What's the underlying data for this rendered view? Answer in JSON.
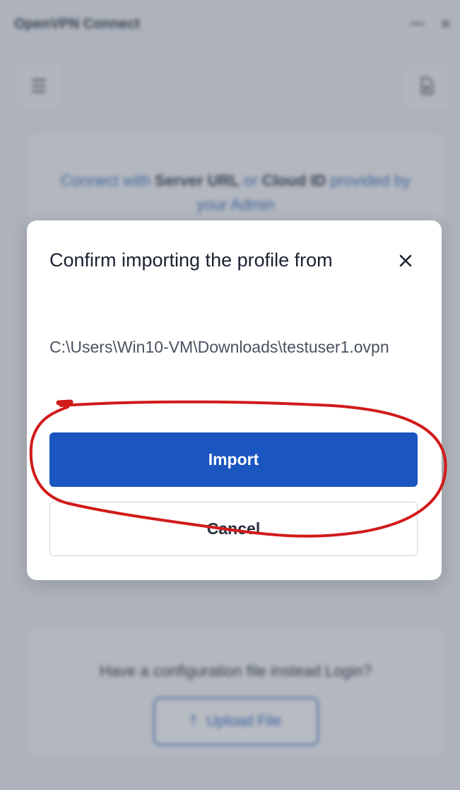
{
  "window": {
    "title": "OpenVPN Connect",
    "minimize_glyph": "—",
    "close_glyph": "✕"
  },
  "toolbar": {
    "menu_icon": "hamburger-menu-icon",
    "import_icon": "import-profile-icon"
  },
  "background": {
    "hint_prefix": "Connect with ",
    "hint_server": "Server URL",
    "hint_middle": " or ",
    "hint_cloud": "Cloud ID",
    "hint_suffix": " provided by your Admin",
    "upload_question": "Have a configuration file instead Login?",
    "upload_label": "Upload File"
  },
  "modal": {
    "title": "Confirm importing the profile from",
    "path": "C:\\Users\\Win10-VM\\Downloads\\testuser1.ovpn",
    "import_label": "Import",
    "cancel_label": "Cancel"
  },
  "colors": {
    "primary": "#1a55c0",
    "annotation": "#d11a1a",
    "overlay": "#5f6878"
  }
}
